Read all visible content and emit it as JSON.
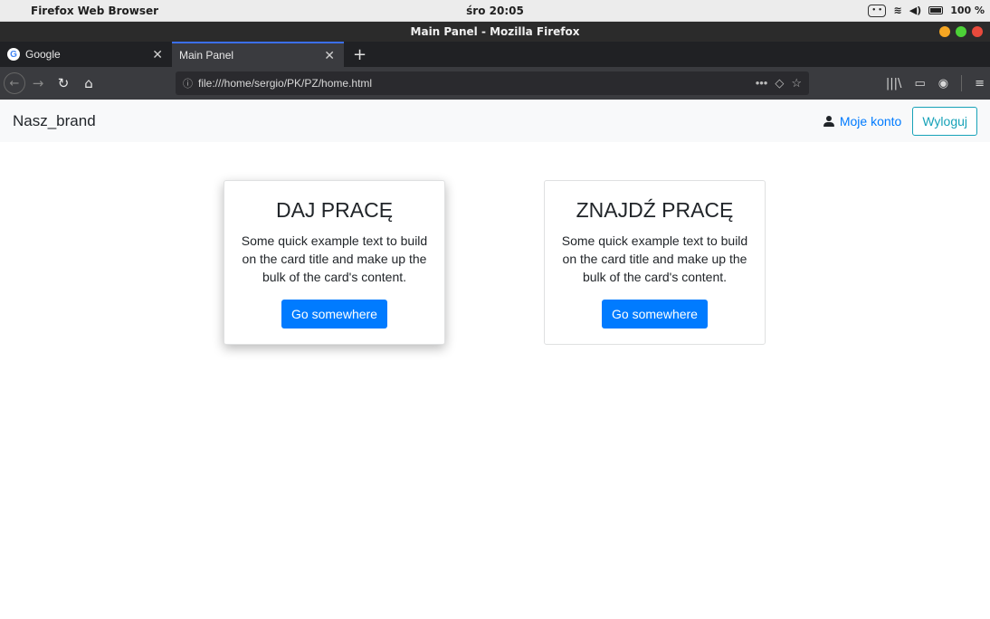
{
  "system_bar": {
    "app_name": "Firefox Web Browser",
    "clock": "śro 20:05",
    "battery": "100 %"
  },
  "window": {
    "title": "Main Panel - Mozilla Firefox"
  },
  "tabs": [
    {
      "label": "Google"
    },
    {
      "label": "Main Panel"
    }
  ],
  "url": {
    "value": "file:///home/sergio/PK/PZ/home.html"
  },
  "page": {
    "brand": "Nasz_brand",
    "account_link": "Moje konto",
    "logout_button": "Wyloguj",
    "cards": [
      {
        "title": "DAJ PRACĘ",
        "text": "Some quick example text to build on the card title and make up the bulk of the card's content.",
        "button": "Go somewhere"
      },
      {
        "title": "ZNAJDŹ PRACĘ",
        "text": "Some quick example text to build on the card title and make up the bulk of the card's content.",
        "button": "Go somewhere"
      }
    ]
  },
  "colors": {
    "primary": "#007bff",
    "info": "#17a2b8",
    "navbar_bg": "#f8f9fa"
  }
}
